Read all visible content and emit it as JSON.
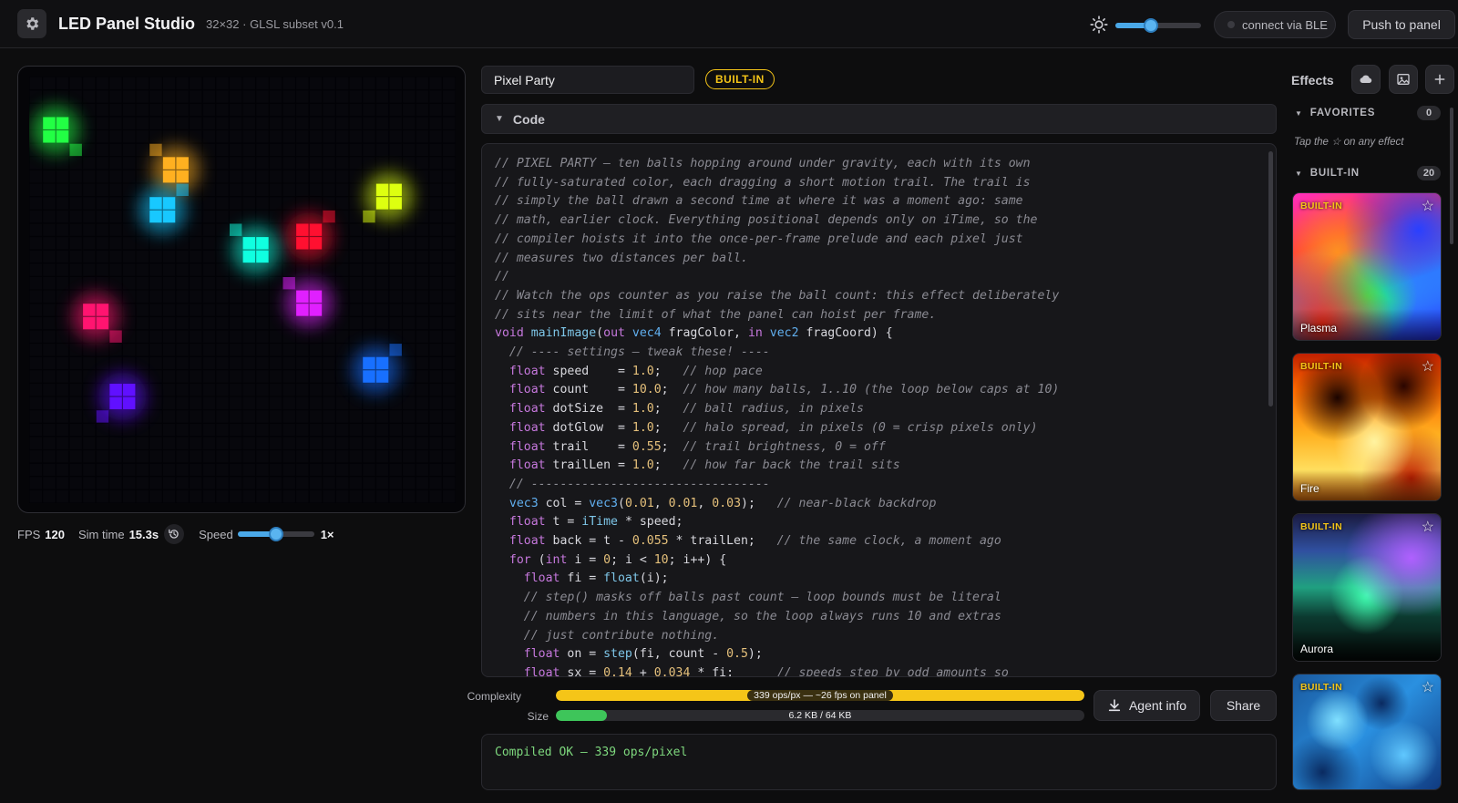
{
  "topbar": {
    "title": "LED Panel Studio",
    "subtitle": "32×32 · GLSL subset v0.1",
    "brightness": 0.42,
    "ble_label": "connect via BLE",
    "push_label": "Push to panel"
  },
  "preview": {
    "fps_label": "FPS",
    "fps_value": "120",
    "sim_label": "Sim time",
    "sim_value": "15.3s",
    "speed_label": "Speed",
    "speed_value": "1×",
    "speed_position": 0.5
  },
  "editor": {
    "effect_name": "Pixel Party",
    "badge": "BUILT-IN",
    "code_section_label": "Code",
    "code_lines": [
      [
        [
          "com",
          "// PIXEL PARTY — ten balls hopping around under gravity, each with its own"
        ]
      ],
      [
        [
          "com",
          "// fully-saturated color, each dragging a short motion trail. The trail is"
        ]
      ],
      [
        [
          "com",
          "// simply the ball drawn a second time at where it was a moment ago: same"
        ]
      ],
      [
        [
          "com",
          "// math, earlier clock. Everything positional depends only on iTime, so the"
        ]
      ],
      [
        [
          "com",
          "// compiler hoists it into the once-per-frame prelude and each pixel just"
        ]
      ],
      [
        [
          "com",
          "// measures two distances per ball."
        ]
      ],
      [
        [
          "com",
          "//"
        ]
      ],
      [
        [
          "com",
          "// Watch the ops counter as you raise the ball count: this effect deliberately"
        ]
      ],
      [
        [
          "com",
          "// sits near the limit of what the panel can hoist per frame."
        ]
      ],
      [
        [
          "kw",
          "void "
        ],
        [
          "fn",
          "mainImage"
        ],
        [
          "",
          "("
        ],
        [
          "kw",
          "out "
        ],
        [
          "ty",
          "vec4 "
        ],
        [
          "",
          "fragColor, "
        ],
        [
          "kw",
          "in "
        ],
        [
          "ty",
          "vec2 "
        ],
        [
          "",
          "fragCoord) {"
        ]
      ],
      [
        [
          "",
          "  "
        ],
        [
          "com",
          "// ---- settings — tweak these! ----"
        ]
      ],
      [
        [
          "",
          "  "
        ],
        [
          "kw",
          "float "
        ],
        [
          "",
          "speed    = "
        ],
        [
          "num",
          "1.0"
        ],
        [
          "",
          ";   "
        ],
        [
          "com",
          "// hop pace"
        ]
      ],
      [
        [
          "",
          "  "
        ],
        [
          "kw",
          "float "
        ],
        [
          "",
          "count    = "
        ],
        [
          "num",
          "10.0"
        ],
        [
          "",
          ";  "
        ],
        [
          "com",
          "// how many balls, 1..10 (the loop below caps at 10)"
        ]
      ],
      [
        [
          "",
          "  "
        ],
        [
          "kw",
          "float "
        ],
        [
          "",
          "dotSize  = "
        ],
        [
          "num",
          "1.0"
        ],
        [
          "",
          ";   "
        ],
        [
          "com",
          "// ball radius, in pixels"
        ]
      ],
      [
        [
          "",
          "  "
        ],
        [
          "kw",
          "float "
        ],
        [
          "",
          "dotGlow  = "
        ],
        [
          "num",
          "1.0"
        ],
        [
          "",
          ";   "
        ],
        [
          "com",
          "// halo spread, in pixels (0 = crisp pixels only)"
        ]
      ],
      [
        [
          "",
          "  "
        ],
        [
          "kw",
          "float "
        ],
        [
          "",
          "trail    = "
        ],
        [
          "num",
          "0.55"
        ],
        [
          "",
          ";  "
        ],
        [
          "com",
          "// trail brightness, 0 = off"
        ]
      ],
      [
        [
          "",
          "  "
        ],
        [
          "kw",
          "float "
        ],
        [
          "",
          "trailLen = "
        ],
        [
          "num",
          "1.0"
        ],
        [
          "",
          ";   "
        ],
        [
          "com",
          "// how far back the trail sits"
        ]
      ],
      [
        [
          "",
          "  "
        ],
        [
          "com",
          "// ---------------------------------"
        ]
      ],
      [
        [
          "",
          "  "
        ],
        [
          "ty",
          "vec3 "
        ],
        [
          "",
          "col = "
        ],
        [
          "ty",
          "vec3"
        ],
        [
          "",
          "("
        ],
        [
          "num",
          "0.01"
        ],
        [
          "",
          ", "
        ],
        [
          "num",
          "0.01"
        ],
        [
          "",
          ", "
        ],
        [
          "num",
          "0.03"
        ],
        [
          "",
          ");   "
        ],
        [
          "com",
          "// near-black backdrop"
        ]
      ],
      [
        [
          "",
          "  "
        ],
        [
          "kw",
          "float "
        ],
        [
          "",
          "t = "
        ],
        [
          "fn",
          "iTime"
        ],
        [
          "",
          " * speed;"
        ]
      ],
      [
        [
          "",
          "  "
        ],
        [
          "kw",
          "float "
        ],
        [
          "",
          "back = t - "
        ],
        [
          "num",
          "0.055"
        ],
        [
          "",
          " * trailLen;   "
        ],
        [
          "com",
          "// the same clock, a moment ago"
        ]
      ],
      [
        [
          "",
          "  "
        ],
        [
          "kw",
          "for "
        ],
        [
          "",
          "("
        ],
        [
          "kw",
          "int "
        ],
        [
          "",
          "i = "
        ],
        [
          "num",
          "0"
        ],
        [
          "",
          "; i < "
        ],
        [
          "num",
          "10"
        ],
        [
          "",
          "; i++) {"
        ]
      ],
      [
        [
          "",
          "    "
        ],
        [
          "kw",
          "float "
        ],
        [
          "",
          "fi = "
        ],
        [
          "fn",
          "float"
        ],
        [
          "",
          "(i);"
        ]
      ],
      [
        [
          "",
          "    "
        ],
        [
          "com",
          "// step() masks off balls past count — loop bounds must be literal"
        ]
      ],
      [
        [
          "",
          "    "
        ],
        [
          "com",
          "// numbers in this language, so the loop always runs 10 and extras"
        ]
      ],
      [
        [
          "",
          "    "
        ],
        [
          "com",
          "// just contribute nothing."
        ]
      ],
      [
        [
          "",
          "    "
        ],
        [
          "kw",
          "float "
        ],
        [
          "",
          "on = "
        ],
        [
          "fn",
          "step"
        ],
        [
          "",
          "(fi, count - "
        ],
        [
          "num",
          "0.5"
        ],
        [
          "",
          ");"
        ]
      ],
      [
        [
          "",
          "    "
        ],
        [
          "kw",
          "float "
        ],
        [
          "",
          "sx = "
        ],
        [
          "num",
          "0.14"
        ],
        [
          "",
          " + "
        ],
        [
          "num",
          "0.034"
        ],
        [
          "",
          " * fi;      "
        ],
        [
          "com",
          "// speeds step by odd amounts so"
        ]
      ]
    ],
    "complexity_label": "Complexity",
    "complexity_text": "339 ops/px — ~26 fps on panel",
    "complexity_fraction": 1.0,
    "size_label": "Size",
    "size_text": "6.2 KB / 64 KB",
    "size_fraction": 0.097,
    "agent_label": "Agent info",
    "share_label": "Share",
    "console_text": "Compiled OK — 339 ops/pixel"
  },
  "effects": {
    "title": "Effects",
    "favorites_label": "FAVORITES",
    "favorites_count": "0",
    "favorites_hint": "Tap the ☆ on any effect",
    "builtin_label": "BUILT-IN",
    "builtin_count": "20",
    "cards": [
      {
        "badge": "BUILT-IN",
        "name": "Plasma",
        "star": "☆"
      },
      {
        "badge": "BUILT-IN",
        "name": "Fire",
        "star": "☆"
      },
      {
        "badge": "BUILT-IN",
        "name": "Aurora",
        "star": "☆"
      },
      {
        "badge": "BUILT-IN",
        "name": "",
        "star": "☆"
      }
    ]
  },
  "balls": [
    {
      "color": "#22ff44",
      "gx": 1,
      "gy": 3
    },
    {
      "color": "#ffb020",
      "gx": 10,
      "gy": 6
    },
    {
      "color": "#18c8ff",
      "gx": 9,
      "gy": 9
    },
    {
      "color": "#ddff10",
      "gx": 26,
      "gy": 8
    },
    {
      "color": "#ff1030",
      "gx": 20,
      "gy": 11
    },
    {
      "color": "#10ffe0",
      "gx": 16,
      "gy": 12
    },
    {
      "color": "#ff1470",
      "gx": 4,
      "gy": 17
    },
    {
      "color": "#e020ff",
      "gx": 20,
      "gy": 16
    },
    {
      "color": "#1870ff",
      "gx": 25,
      "gy": 21
    },
    {
      "color": "#6010ff",
      "gx": 6,
      "gy": 23
    }
  ]
}
